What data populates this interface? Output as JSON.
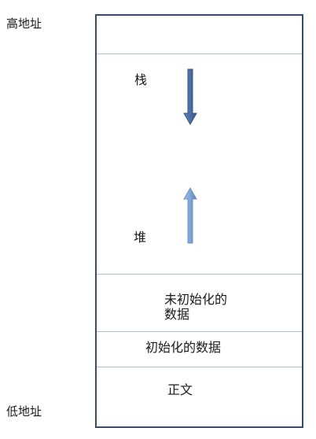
{
  "address": {
    "high": "高地址",
    "low": "低地址"
  },
  "segments": {
    "stack": "栈",
    "heap": "堆",
    "bss_line1": "未初始化的",
    "bss_line2": "数据",
    "data": "初始化的数据",
    "text": "正文"
  },
  "arrows": {
    "stack_direction": "down",
    "heap_direction": "up",
    "stack_color": "#4a6fa5",
    "heap_color": "#7ea3d6"
  }
}
